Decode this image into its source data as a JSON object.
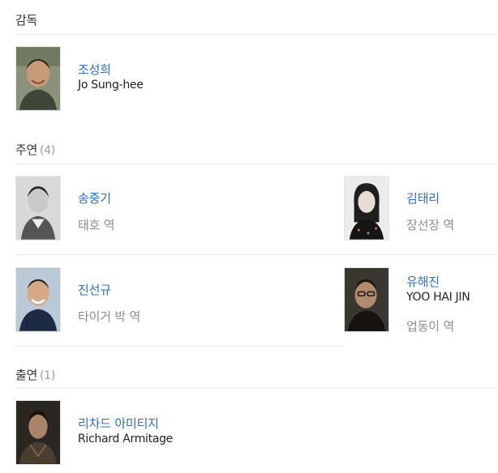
{
  "sections": {
    "director": {
      "title": "감독",
      "people": [
        {
          "name_ko": "조성희",
          "name_en": "Jo Sung-hee",
          "photo_icon": "director-portrait"
        }
      ]
    },
    "lead": {
      "title": "주연",
      "count": "(4)",
      "people": [
        {
          "name_ko": "송중기",
          "role": "태호 역",
          "photo_icon": "actor-portrait"
        },
        {
          "name_ko": "김태리",
          "role": "장선장 역",
          "photo_icon": "actress-portrait"
        },
        {
          "name_ko": "진선규",
          "role": "타이거 박 역",
          "photo_icon": "actor-portrait"
        },
        {
          "name_ko": "유해진",
          "name_en": "YOO HAI JIN",
          "role": "업동이 역",
          "photo_icon": "actor-portrait"
        }
      ]
    },
    "supporting": {
      "title": "출연",
      "count": "(1)",
      "people": [
        {
          "name_ko": "리차드 아미티지",
          "name_en": "Richard Armitage",
          "photo_icon": "actor-portrait"
        }
      ]
    }
  },
  "colors": {
    "link": "#2b6fc7",
    "role": "#8e8e8e",
    "divider": "#ececec"
  }
}
